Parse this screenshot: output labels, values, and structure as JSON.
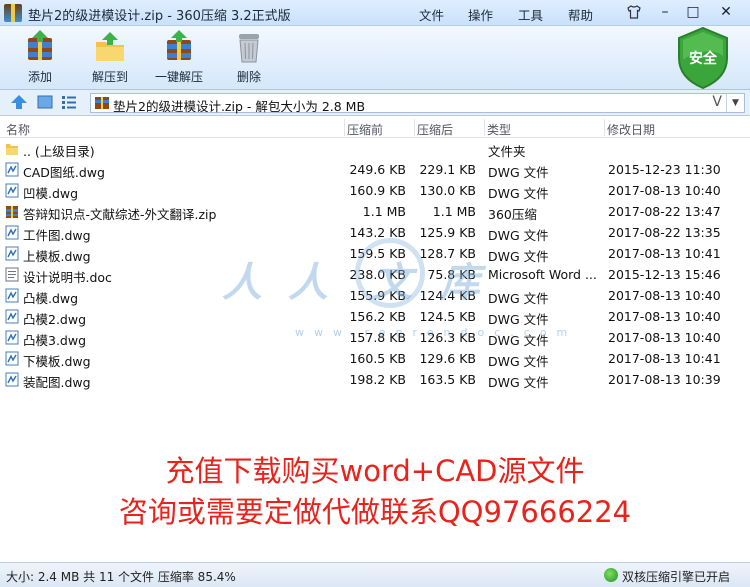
{
  "window": {
    "title": "垫片2的级进模设计.zip - 360压缩 3.2正式版",
    "menus": [
      "文件",
      "操作",
      "工具",
      "帮助"
    ]
  },
  "toolbar": {
    "add": "添加",
    "extract_to": "解压到",
    "one_click_extract": "一键解压",
    "delete": "删除",
    "security_badge": "安全"
  },
  "address": {
    "path": "垫片2的级进模设计.zip - 解包大小为 2.8 MB",
    "v_mark": "V"
  },
  "columns": {
    "name": "名称",
    "size": "压缩前",
    "packed": "压缩后",
    "type": "类型",
    "modified": "修改日期"
  },
  "files": [
    {
      "name": ".. (上级目录)",
      "size": "",
      "packed": "",
      "type": "文件夹",
      "date": "",
      "icon": "folder-icon"
    },
    {
      "name": "CAD图纸.dwg",
      "size": "249.6 KB",
      "packed": "229.1 KB",
      "type": "DWG 文件",
      "date": "2015-12-23 11:30",
      "icon": "dwg-file-icon"
    },
    {
      "name": "凹模.dwg",
      "size": "160.9 KB",
      "packed": "130.0 KB",
      "type": "DWG 文件",
      "date": "2017-08-13 10:40",
      "icon": "dwg-file-icon"
    },
    {
      "name": "答辩知识点-文献综述-外文翻译.zip",
      "size": "1.1 MB",
      "packed": "1.1 MB",
      "type": "360压缩",
      "date": "2017-08-22 13:47",
      "icon": "zip-archive-icon"
    },
    {
      "name": "工件图.dwg",
      "size": "143.2 KB",
      "packed": "125.9 KB",
      "type": "DWG 文件",
      "date": "2017-08-22 13:35",
      "icon": "dwg-file-icon"
    },
    {
      "name": "上模板.dwg",
      "size": "159.5 KB",
      "packed": "128.7 KB",
      "type": "DWG 文件",
      "date": "2017-08-13 10:41",
      "icon": "dwg-file-icon"
    },
    {
      "name": "设计说明书.doc",
      "size": "238.0 KB",
      "packed": "75.8 KB",
      "type": "Microsoft Word ...",
      "date": "2015-12-13 15:46",
      "icon": "doc-file-icon"
    },
    {
      "name": "凸模.dwg",
      "size": "155.9 KB",
      "packed": "124.4 KB",
      "type": "DWG 文件",
      "date": "2017-08-13 10:40",
      "icon": "dwg-file-icon"
    },
    {
      "name": "凸模2.dwg",
      "size": "156.2 KB",
      "packed": "124.5 KB",
      "type": "DWG 文件",
      "date": "2017-08-13 10:40",
      "icon": "dwg-file-icon"
    },
    {
      "name": "凸模3.dwg",
      "size": "157.8 KB",
      "packed": "126.3 KB",
      "type": "DWG 文件",
      "date": "2017-08-13 10:40",
      "icon": "dwg-file-icon"
    },
    {
      "name": "下模板.dwg",
      "size": "160.5 KB",
      "packed": "129.6 KB",
      "type": "DWG 文件",
      "date": "2017-08-13 10:41",
      "icon": "dwg-file-icon"
    },
    {
      "name": "装配图.dwg",
      "size": "198.2 KB",
      "packed": "163.5 KB",
      "type": "DWG 文件",
      "date": "2017-08-13 10:39",
      "icon": "dwg-file-icon"
    }
  ],
  "watermark": {
    "chars": [
      "人",
      "人",
      "文",
      "库"
    ],
    "url": "www.renrendoc.com"
  },
  "promo": {
    "line1": "充值下载购买word+CAD源文件",
    "line2": "咨询或需要定做代做联系QQ97666224"
  },
  "status": {
    "summary": "大小: 2.4 MB 共 11 个文件 压缩率 85.4%",
    "engine": "双核压缩引擎已开启"
  },
  "colors": {
    "promo_red": "#e8231c",
    "shield_green": "#3aa53a",
    "titlebar_blue": "#c9e1fb"
  }
}
